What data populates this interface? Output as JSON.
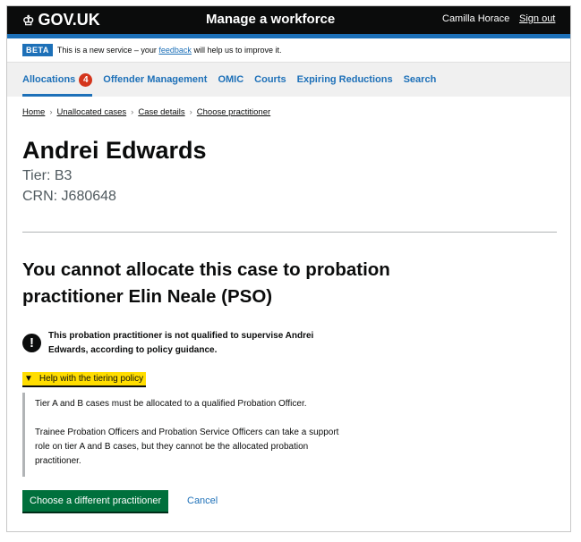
{
  "header": {
    "logo": "GOV.UK",
    "service": "Manage a workforce",
    "user": "Camilla Horace",
    "sign_out": "Sign out"
  },
  "beta": {
    "tag": "BETA",
    "pre": "This is a new service – your",
    "link": "feedback",
    "post": "will help us to improve it."
  },
  "nav": {
    "items": [
      {
        "label": "Allocations",
        "badge": "4"
      },
      {
        "label": "Offender Management"
      },
      {
        "label": "OMIC"
      },
      {
        "label": "Courts"
      },
      {
        "label": "Expiring Reductions"
      },
      {
        "label": "Search"
      }
    ]
  },
  "breadcrumb": [
    "Home",
    "Unallocated cases",
    "Case details",
    "Choose practitioner"
  ],
  "person": {
    "name": "Andrei Edwards",
    "tier": "Tier: B3",
    "crn": "CRN: J680648"
  },
  "heading": "You cannot allocate this case to probation practitioner Elin Neale (PSO)",
  "warning": "This probation practitioner is not qualified to supervise Andrei Edwards, according to policy guidance.",
  "details": {
    "summary": "Help with the tiering policy",
    "p1": "Tier A and B cases must be allocated to a qualified Probation Officer.",
    "p2": "Trainee Probation Officers and Probation Service Officers can take a support role on tier A and B cases, but they cannot be the allocated probation practitioner."
  },
  "actions": {
    "primary": "Choose a different practitioner",
    "cancel": "Cancel"
  }
}
